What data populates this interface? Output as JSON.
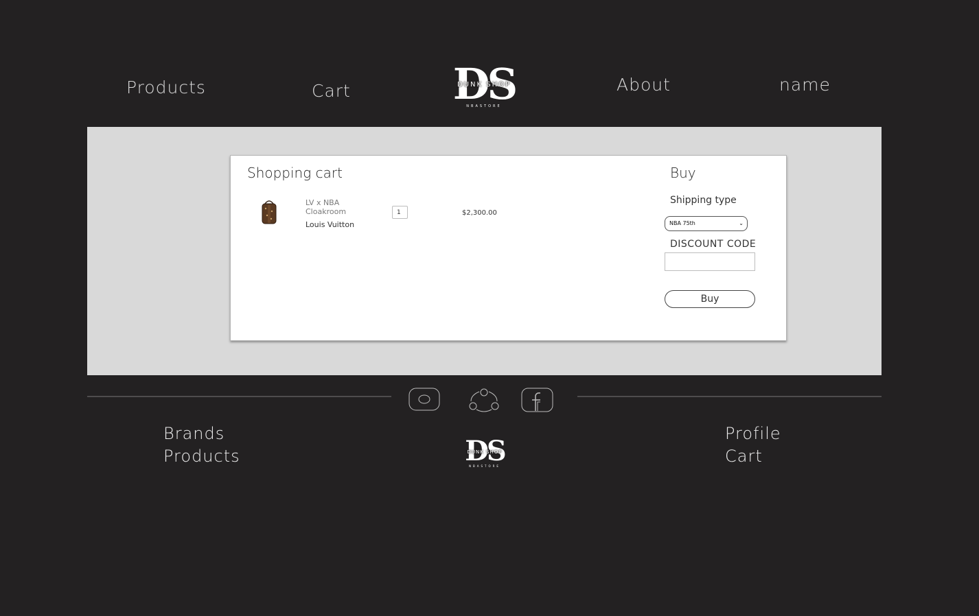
{
  "nav": {
    "products": "Products",
    "cart": "Cart",
    "about": "About",
    "user": "name"
  },
  "logo": {
    "mark": "DS",
    "name": "DUNK SHOP",
    "tagline": "NBASTORE"
  },
  "cart": {
    "title": "Shopping cart",
    "items": [
      {
        "name": "LV x NBA Cloakroom",
        "brand": "Louis Vuitton",
        "quantity": "1",
        "price": "$2,300.00"
      }
    ]
  },
  "buy": {
    "title": "Buy",
    "shipping_label": "Shipping type",
    "shipping_value": "NBA 75th",
    "discount_label": "DISCOUNT CODE",
    "discount_value": "",
    "button_label": "Buy"
  },
  "footer": {
    "social_icons": [
      "instagram-icon",
      "community-icon",
      "facebook-icon"
    ],
    "left_links": [
      "Brands",
      "Products"
    ],
    "right_links": [
      "Profile",
      "Cart"
    ]
  },
  "colors": {
    "background": "#232122",
    "panel": "#d9d9d9",
    "card": "#ffffff",
    "nav_text": "#d9d9d9"
  }
}
